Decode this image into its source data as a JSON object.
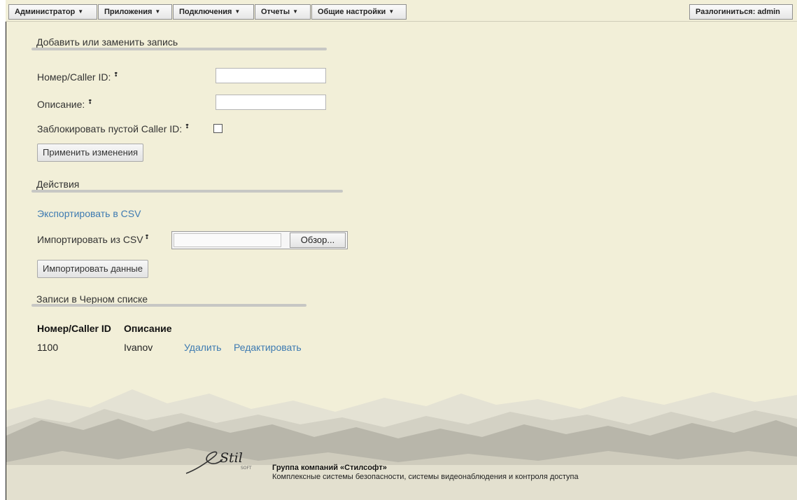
{
  "nav": {
    "menus": [
      {
        "label": "Администратор"
      },
      {
        "label": "Приложения"
      },
      {
        "label": "Подключения"
      },
      {
        "label": "Отчеты"
      },
      {
        "label": "Общие настройки"
      }
    ],
    "logout_label": "Разлогиниться: admin"
  },
  "add_section": {
    "title": "Добавить или заменить запись",
    "number_label": "Номер/Caller ID:",
    "number_value": "",
    "description_label": "Описание:",
    "description_value": "",
    "block_empty_label": "Заблокировать пустой Caller ID:",
    "block_empty_checked": false,
    "apply_button": "Применить изменения",
    "help_glyph": "❢"
  },
  "actions_section": {
    "title": "Действия",
    "export_link": "Экспортировать в CSV",
    "import_label": "Импортировать из CSV",
    "browse_button": "Обзор...",
    "import_button": "Импортировать данные"
  },
  "entries_section": {
    "title": "Записи в Черном списке",
    "columns": [
      "Номер/Caller ID",
      "Описание"
    ],
    "rows": [
      {
        "number": "1100",
        "description": "Ivanov",
        "delete_label": "Удалить",
        "edit_label": "Редактировать"
      }
    ]
  },
  "footer": {
    "company": "Группа компаний «Стилсофт»",
    "tagline": "Комплексные системы безопасности, системы видеонаблюдения и контроля доступа",
    "logo_text": "Stil",
    "logo_sub": "SOFT"
  },
  "colors": {
    "background": "#f2efd8",
    "link": "#3d7ab1",
    "rule": "#c7c7c4"
  }
}
